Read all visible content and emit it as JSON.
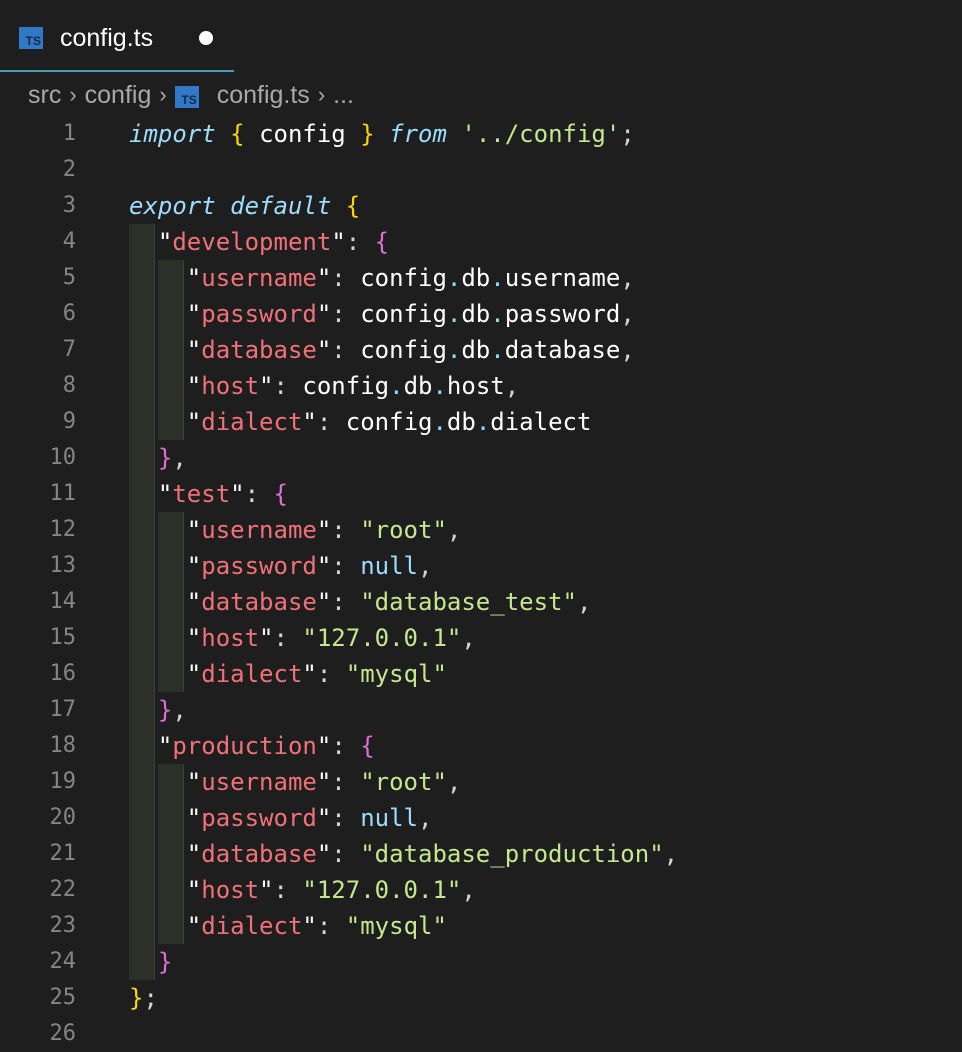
{
  "tab": {
    "title": "config.ts",
    "icon": "ts-file-icon",
    "icon_text": "TS",
    "dirty": true
  },
  "breadcrumb": {
    "segments": [
      "src",
      "config",
      "config.ts",
      "..."
    ]
  },
  "colors": {
    "background": "#1e1e1e",
    "tab_underline": "#4a9bb5",
    "ts_icon": "#3178c6"
  },
  "code_lines": [
    "import { config } from '../config';",
    "",
    "export default {",
    "  \"development\": {",
    "    \"username\": config.db.username,",
    "    \"password\": config.db.password,",
    "    \"database\": config.db.database,",
    "    \"host\": config.db.host,",
    "    \"dialect\": config.db.dialect",
    "  },",
    "  \"test\": {",
    "    \"username\": \"root\",",
    "    \"password\": null,",
    "    \"database\": \"database_test\",",
    "    \"host\": \"127.0.0.1\",",
    "    \"dialect\": \"mysql\"",
    "  },",
    "  \"production\": {",
    "    \"username\": \"root\",",
    "    \"password\": null,",
    "    \"database\": \"database_production\",",
    "    \"host\": \"127.0.0.1\",",
    "    \"dialect\": \"mysql\"",
    "  }",
    "};",
    ""
  ]
}
